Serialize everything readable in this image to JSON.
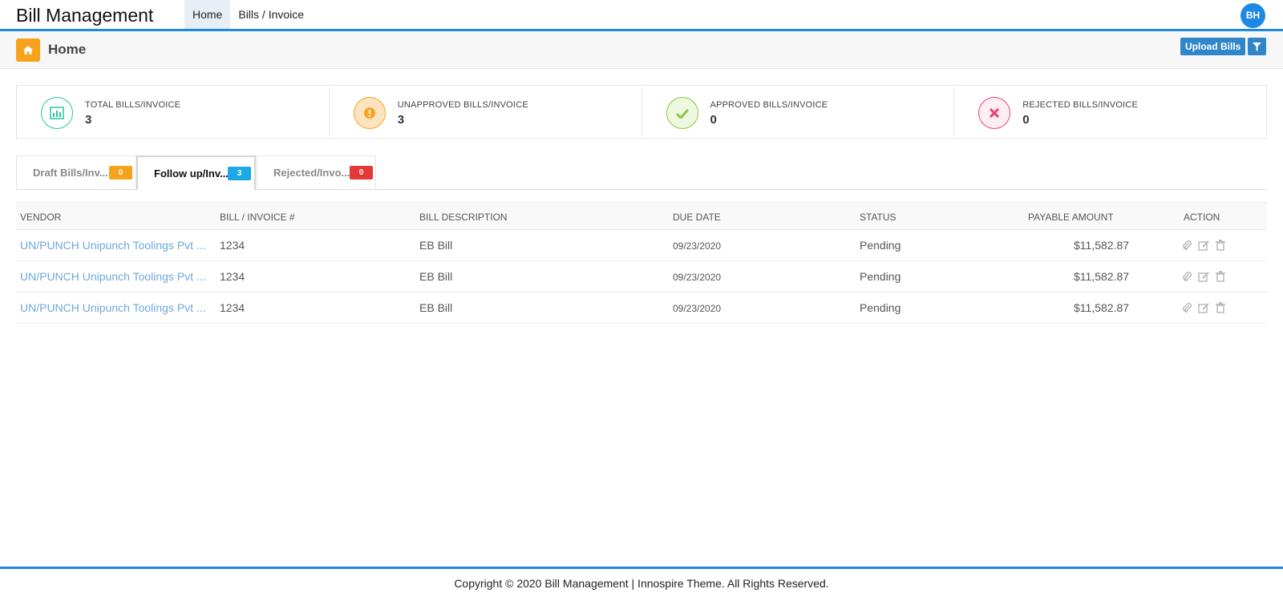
{
  "app": {
    "title": "Bill Management",
    "avatar_initials": "BH"
  },
  "nav": {
    "items": [
      {
        "label": "Home",
        "active": true
      },
      {
        "label": "Bills / Invoice",
        "active": false
      }
    ]
  },
  "page": {
    "title": "Home",
    "home_icon": "home-icon",
    "upload_label": "Upload Bills",
    "filter_icon": "filter-icon"
  },
  "stats": [
    {
      "label": "TOTAL BILLS/INVOICE",
      "value": "3",
      "icon": "bar-chart-icon",
      "color": "#26c6a0"
    },
    {
      "label": "UNAPPROVED BILLS/INVOICE",
      "value": "3",
      "icon": "exclamation-icon",
      "color": "#f5a623"
    },
    {
      "label": "APPROVED BILLS/INVOICE",
      "value": "0",
      "icon": "check-icon",
      "color": "#8cc63f"
    },
    {
      "label": "REJECTED BILLS/INVOICE",
      "value": "0",
      "icon": "close-icon",
      "color": "#ec407a"
    }
  ],
  "tabs": [
    {
      "label": "Draft Bills/Inv...",
      "count": "0",
      "color": "#f7a21b",
      "active": false
    },
    {
      "label": "Follow up/Inv...",
      "count": "3",
      "color": "#1ba9e8",
      "active": true
    },
    {
      "label": "Rejected/Invo...",
      "count": "0",
      "color": "#e53935",
      "active": false
    }
  ],
  "table": {
    "columns": [
      "VENDOR",
      "BILL / INVOICE #",
      "BILL DESCRIPTION",
      "DUE DATE",
      "STATUS",
      "PAYABLE AMOUNT",
      "ACTION"
    ],
    "rows": [
      {
        "vendor": "UN/PUNCH Unipunch Toolings Pvt ...",
        "invoice": "1234",
        "description": "EB Bill",
        "due_date": "09/23/2020",
        "status": "Pending",
        "amount": "$11,582.87"
      },
      {
        "vendor": "UN/PUNCH Unipunch Toolings Pvt ...",
        "invoice": "1234",
        "description": "EB Bill",
        "due_date": "09/23/2020",
        "status": "Pending",
        "amount": "$11,582.87"
      },
      {
        "vendor": "UN/PUNCH Unipunch Toolings Pvt ...",
        "invoice": "1234",
        "description": "EB Bill",
        "due_date": "09/23/2020",
        "status": "Pending",
        "amount": "$11,582.87"
      }
    ],
    "action_icons": [
      "paperclip-icon",
      "edit-icon",
      "trash-icon"
    ]
  },
  "footer": {
    "text": "Copyright © 2020 Bill Management | Innospire Theme. All Rights Reserved."
  }
}
